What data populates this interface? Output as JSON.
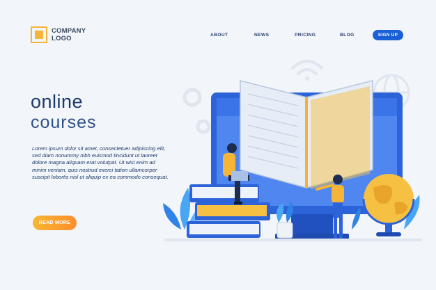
{
  "header": {
    "logo_line1": "COMPANY",
    "logo_line2": "LOGO",
    "nav": [
      "ABOUT",
      "NEWS",
      "PRICING",
      "BLOG"
    ],
    "signup_label": "SIGN UP"
  },
  "hero": {
    "title_line1": "online",
    "title_line2": "courses",
    "body": "Lorem ipsum dolor sit amet, consectetuer adipiscing elit, sed diam nonummy nibh euismod tincidunt ut laoreet dolore magna aliquam erat volutpat. Ut wisi enim ad minim veniam, quis nostrud exerci tation ullamcorper suscipit lobortis nisl ut aliquip ex ea commodo consequat.",
    "read_more_label": "READ MORE"
  },
  "colors": {
    "primary": "#1a5fd6",
    "heading": "#1c3a6b",
    "accent_orange": "#f7b733",
    "background": "#f2f5f9"
  }
}
